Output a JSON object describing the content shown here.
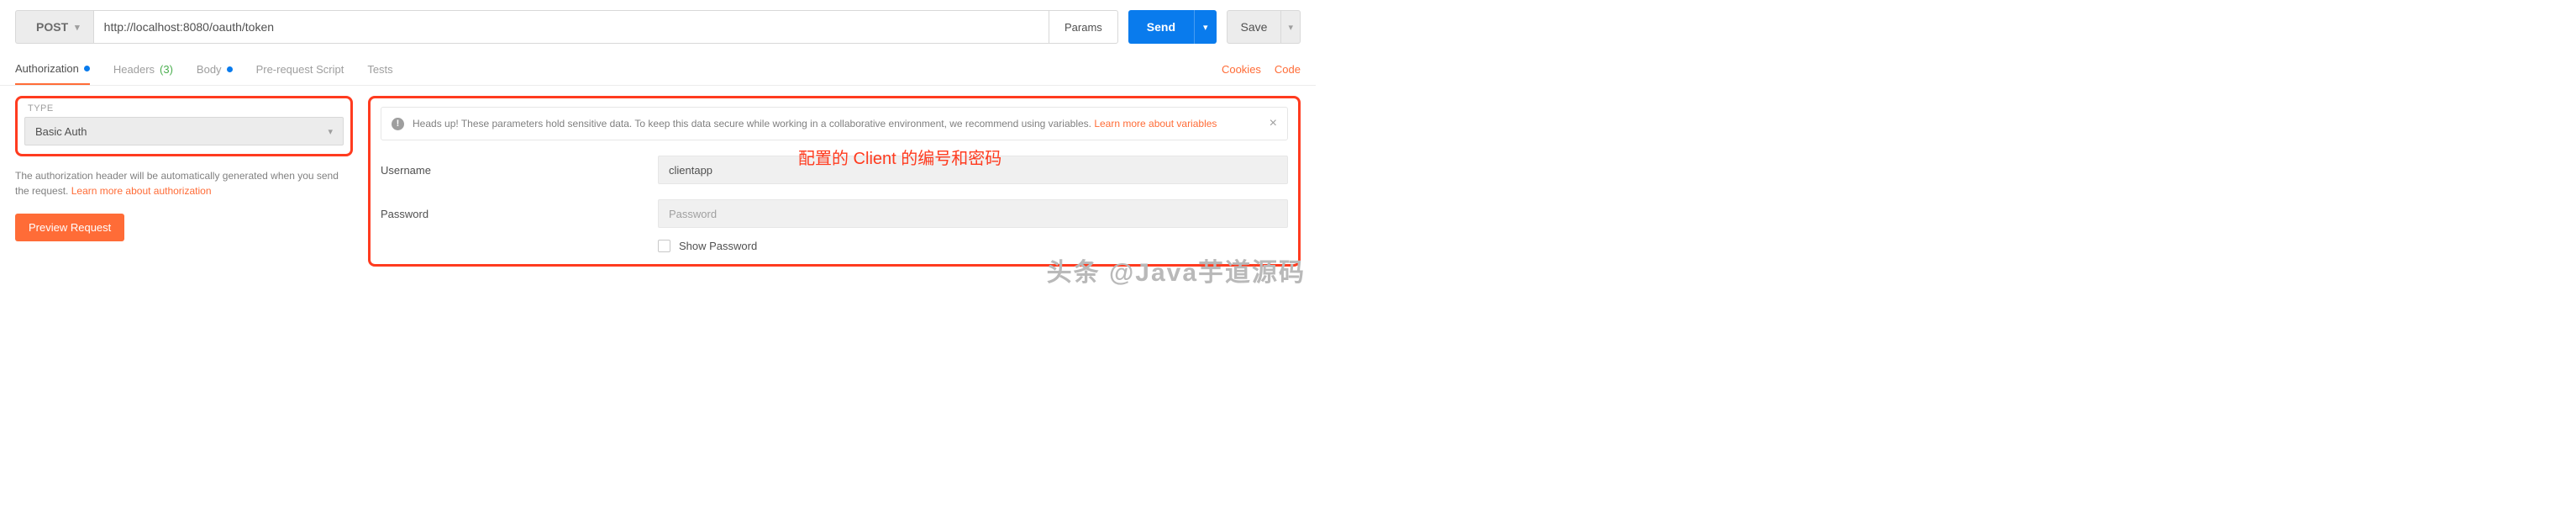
{
  "request": {
    "method": "POST",
    "url": "http://localhost:8080/oauth/token",
    "params_btn": "Params",
    "send_btn": "Send",
    "save_btn": "Save"
  },
  "tabs": {
    "authorization": "Authorization",
    "headers": "Headers",
    "headers_count": "(3)",
    "body": "Body",
    "prerequest": "Pre-request Script",
    "tests": "Tests"
  },
  "rightlinks": {
    "cookies": "Cookies",
    "code": "Code"
  },
  "auth": {
    "type_label": "TYPE",
    "type_value": "Basic Auth",
    "help_text": "The authorization header will be automatically generated when you send the request. ",
    "help_link": "Learn more about authorization",
    "preview_btn": "Preview Request"
  },
  "alert": {
    "text": "Heads up! These parameters hold sensitive data. To keep this data secure while working in a collaborative environment, we recommend using variables. ",
    "link": "Learn more about variables"
  },
  "form": {
    "username_label": "Username",
    "username_value": "clientapp",
    "password_label": "Password",
    "password_placeholder": "Password",
    "show_password": "Show Password"
  },
  "annotation": "配置的 Client 的编号和密码",
  "watermark": "头条 @Java芋道源码"
}
